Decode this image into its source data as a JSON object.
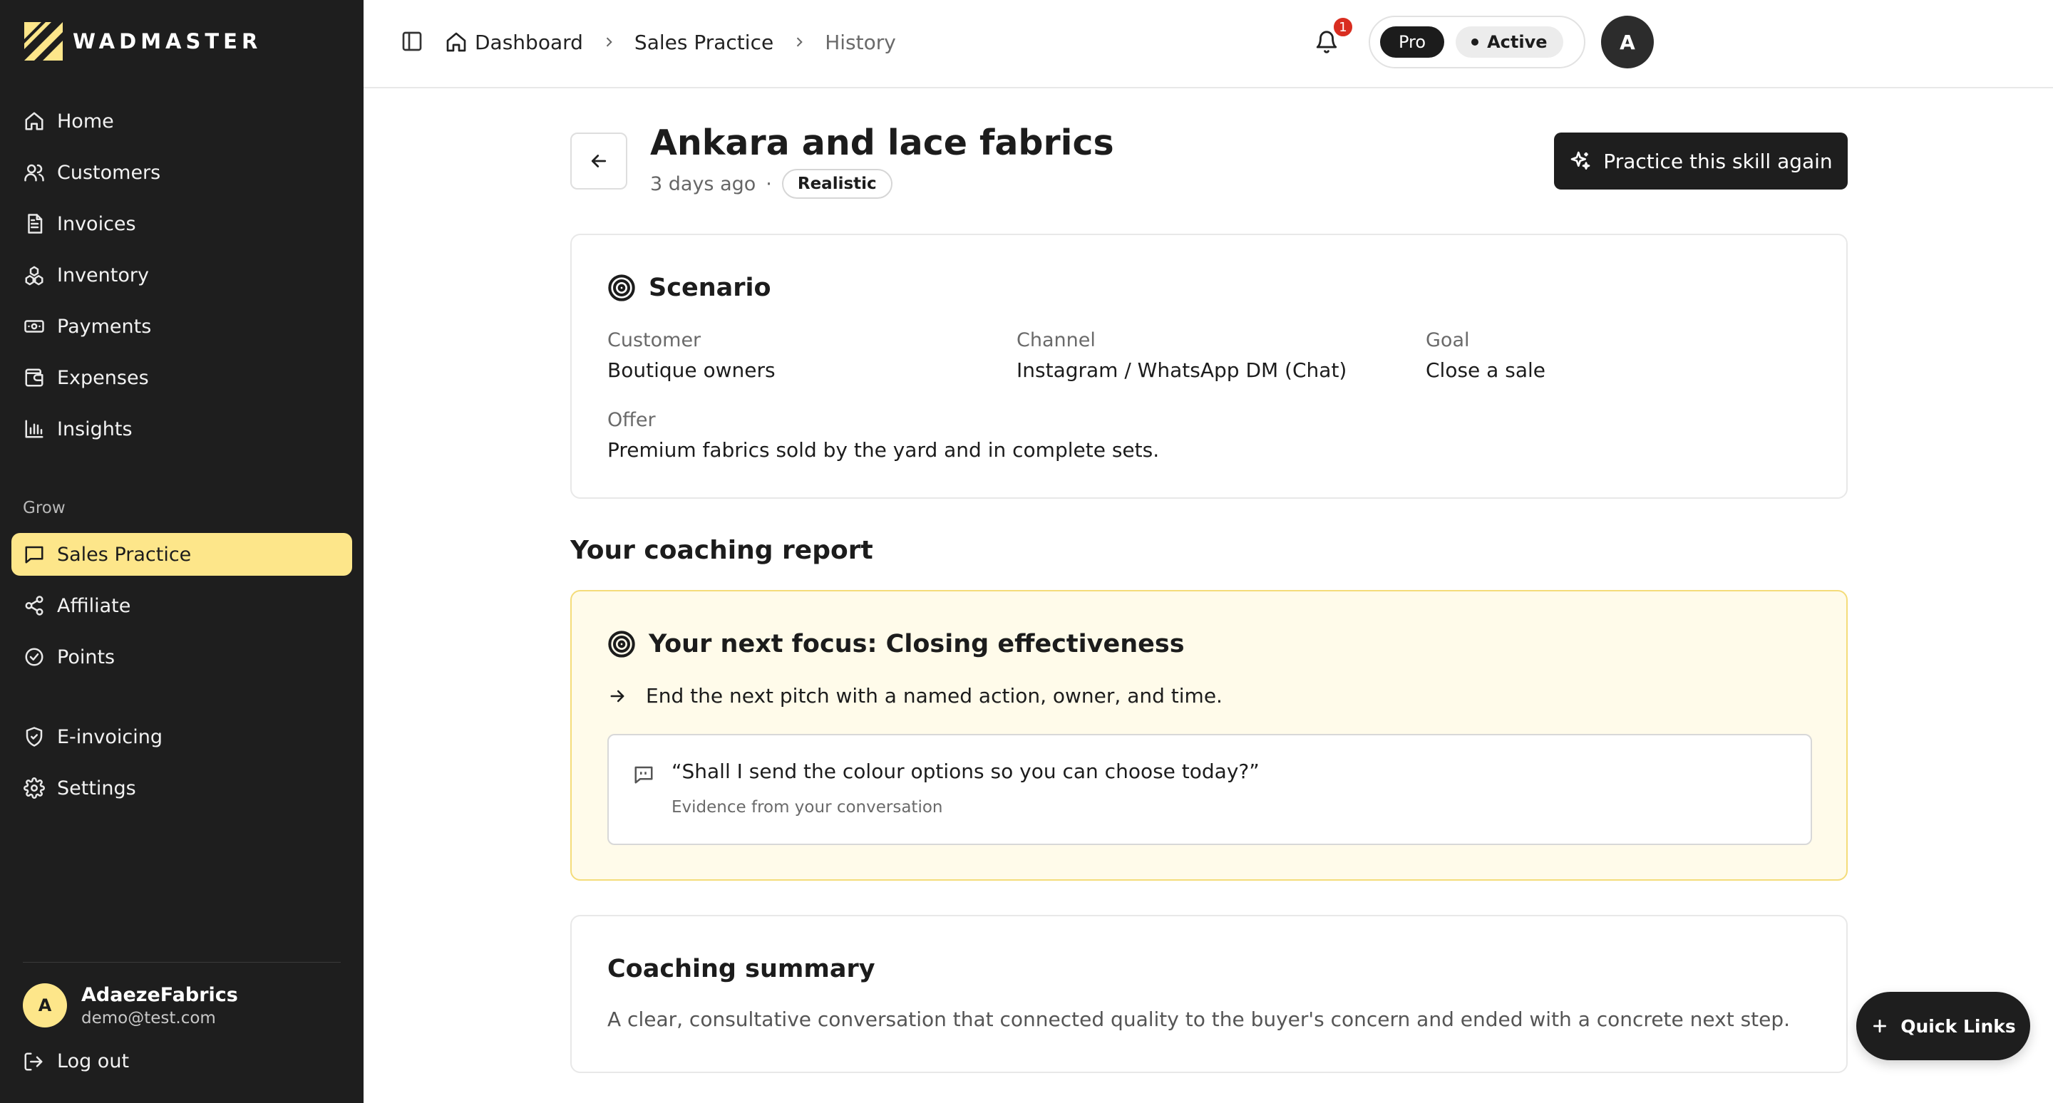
{
  "brand": {
    "name": "WADMASTER",
    "accent_color": "#fde68a",
    "sidebar_color": "#1e1e1e"
  },
  "sidebar": {
    "main_items": [
      {
        "label": "Home",
        "icon": "home-icon"
      },
      {
        "label": "Customers",
        "icon": "users-icon"
      },
      {
        "label": "Invoices",
        "icon": "document-icon"
      },
      {
        "label": "Inventory",
        "icon": "boxes-icon"
      },
      {
        "label": "Payments",
        "icon": "banknote-icon"
      },
      {
        "label": "Expenses",
        "icon": "wallet-icon"
      },
      {
        "label": "Insights",
        "icon": "bar-chart-icon"
      }
    ],
    "group_label": "Grow",
    "grow_items": [
      {
        "label": "Sales Practice",
        "icon": "message-square-icon",
        "active": true
      },
      {
        "label": "Affiliate",
        "icon": "share-icon"
      },
      {
        "label": "Points",
        "icon": "badge-check-icon"
      }
    ],
    "extra_items": [
      {
        "label": "E-invoicing",
        "icon": "shield-check-icon"
      },
      {
        "label": "Settings",
        "icon": "gear-icon"
      }
    ],
    "user": {
      "initial": "A",
      "name": "AdaezeFabrics",
      "email": "demo@test.com"
    },
    "logout_label": "Log out"
  },
  "topbar": {
    "breadcrumb": [
      "Dashboard",
      "Sales Practice",
      "History"
    ],
    "notification_count": "1",
    "plan": "Pro",
    "status": "Active",
    "avatar_initial": "A"
  },
  "page": {
    "title": "Ankara and lace fabrics",
    "time_ago": "3 days ago",
    "meta_separator": "·",
    "difficulty": "Realistic",
    "practice_button": "Practice this skill again"
  },
  "scenario": {
    "title": "Scenario",
    "customer_label": "Customer",
    "customer_value": "Boutique owners",
    "channel_label": "Channel",
    "channel_value": "Instagram / WhatsApp DM (Chat)",
    "goal_label": "Goal",
    "goal_value": "Close a sale",
    "offer_label": "Offer",
    "offer_value": "Premium fabrics sold by the yard and in complete sets."
  },
  "report": {
    "heading": "Your coaching report",
    "focus_title": "Your next focus: Closing effectiveness",
    "focus_action": "End the next pitch with a named action, owner, and time.",
    "evidence_quote": "“Shall I send the colour options so you can choose today?”",
    "evidence_caption": "Evidence from your conversation",
    "summary_title": "Coaching summary",
    "summary_text": "A clear, consultative conversation that connected quality to the buyer's concern and ended with a concrete next step."
  },
  "quick_links_label": "Quick Links"
}
